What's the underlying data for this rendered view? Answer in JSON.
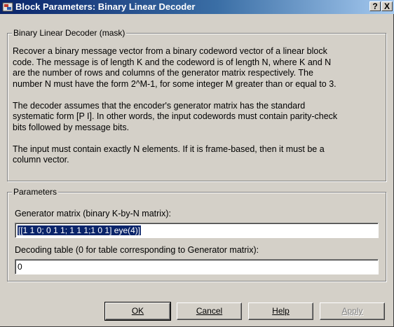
{
  "window": {
    "title": "Block Parameters: Binary Linear Decoder",
    "help_label": "?",
    "close_label": "X"
  },
  "description": {
    "legend": "Binary Linear Decoder (mask)",
    "lines": [
      "Recover a binary message vector from a binary codeword vector of a linear block",
      "code.  The message is of length K and the codeword is of length N, where K and N",
      "are the number of rows and columns of the generator matrix respectively.  The",
      "number N must have the form 2^M-1, for some integer M greater than or equal to 3.",
      "",
      "The decoder assumes that the encoder's generator matrix has the standard",
      "systematic form [P I].  In other words, the input codewords must contain parity-check",
      "bits followed by message bits.",
      "",
      "The input must contain exactly N elements.  If it is frame-based, then it must be a",
      "column vector."
    ]
  },
  "parameters": {
    "legend": "Parameters",
    "generator_label": "Generator matrix (binary K-by-N matrix):",
    "generator_value": "[[1 1 0; 0 1 1; 1 1 1;1 0 1] eye(4)]",
    "decoding_label": "Decoding table (0 for table corresponding to Generator matrix):",
    "decoding_value": "0"
  },
  "buttons": {
    "ok": "OK",
    "cancel": "Cancel",
    "help": "Help",
    "apply": "Apply"
  },
  "colors": {
    "title_bar": "#0a246a",
    "dialog_face": "#d4d0c8",
    "selection": "#0a246a"
  }
}
